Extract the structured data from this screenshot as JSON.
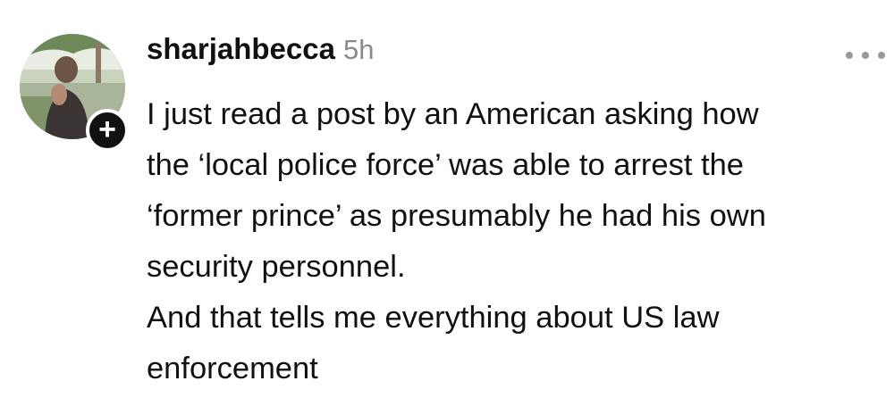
{
  "post": {
    "username": "sharjahbecca",
    "time": "5h",
    "follow_symbol": "+",
    "more_icon": "ellipsis-icon",
    "lines": [
      "I just read a post by an American asking how",
      "the ‘local police force’ was able to arrest the",
      "‘former prince’ as presumably he had his own",
      "security personnel.",
      "And that tells me everything about US law",
      "enforcement"
    ]
  }
}
